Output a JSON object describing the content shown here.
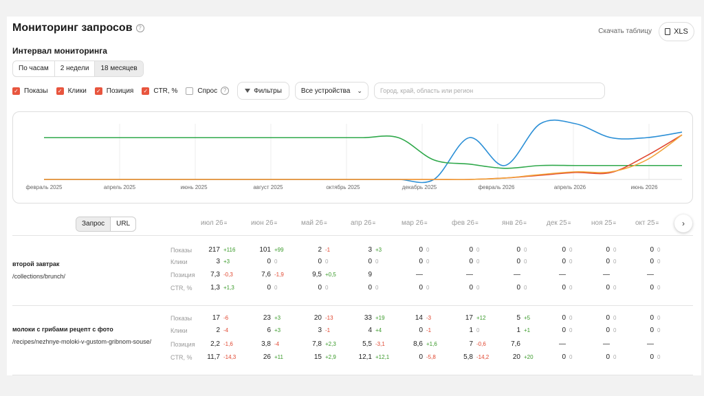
{
  "header": {
    "title": "Мониторинг запросов",
    "download_label": "Скачать таблицу",
    "xls_label": "XLS"
  },
  "interval": {
    "title": "Интервал мониторинга",
    "options": [
      "По часам",
      "2 недели",
      "18 месяцев"
    ],
    "active": 2
  },
  "filters": {
    "checks": [
      {
        "label": "Показы",
        "checked": true
      },
      {
        "label": "Клики",
        "checked": true
      },
      {
        "label": "Позиция",
        "checked": true
      },
      {
        "label": "CTR, %",
        "checked": true
      },
      {
        "label": "Спрос",
        "checked": false
      }
    ],
    "filter_button": "Фильтры",
    "device_select": "Все устройства",
    "region_placeholder": "Город, край, область или регион"
  },
  "chart_data": {
    "type": "line",
    "x_tick_labels": [
      "февраль 2025",
      "апрель 2025",
      "июнь 2025",
      "август 2025",
      "октябрь 2025",
      "декабрь 2025",
      "февраль 2026",
      "апрель 2026",
      "июнь 2026"
    ],
    "x": [
      "2025-01",
      "2025-02",
      "2025-03",
      "2025-04",
      "2025-05",
      "2025-06",
      "2025-07",
      "2025-08",
      "2025-09",
      "2025-10",
      "2025-11",
      "2025-12",
      "2026-01",
      "2026-02",
      "2026-03",
      "2026-04",
      "2026-05",
      "2026-06",
      "2026-07"
    ],
    "series": [
      {
        "color": "#2b8fd6",
        "values": [
          0,
          0,
          0,
          0,
          0,
          0,
          0,
          0,
          0,
          0,
          0,
          0,
          3,
          1,
          4,
          4,
          3,
          3,
          3.4
        ]
      },
      {
        "color": "#2ea84a",
        "values": [
          3,
          3,
          3,
          3,
          3,
          3,
          3,
          3,
          3,
          3,
          3,
          1.4,
          1.1,
          0.8,
          1,
          1,
          1,
          1,
          1
        ]
      },
      {
        "color": "#e0462f",
        "values": [
          0,
          0,
          0,
          0,
          0,
          0,
          0,
          0,
          0,
          0,
          0,
          0,
          0,
          0.1,
          0.3,
          0.5,
          0.5,
          1.7,
          3.2
        ]
      },
      {
        "color": "#f2a33a",
        "values": [
          0,
          0,
          0,
          0,
          0,
          0,
          0,
          0,
          0,
          0,
          0,
          0,
          0,
          0.1,
          0.35,
          0.55,
          0.55,
          1.4,
          3.2
        ]
      }
    ],
    "grid": true
  },
  "table": {
    "tabs": [
      "Запрос",
      "URL"
    ],
    "columns": [
      "июл 26",
      "июн 26",
      "май 26",
      "апр 26",
      "мар 26",
      "фев 26",
      "янв 26",
      "дек 25",
      "ноя 25",
      "окт 25"
    ],
    "metric_labels": [
      "Показы",
      "Клики",
      "Позиция",
      "CTR, %"
    ],
    "rows": [
      {
        "query": "второй завтрак",
        "url": "/collections/brunch/",
        "metrics": [
          [
            {
              "v": "217",
              "d": "+116"
            },
            {
              "v": "101",
              "d": "+99"
            },
            {
              "v": "2",
              "d": "-1"
            },
            {
              "v": "3",
              "d": "+3"
            },
            {
              "v": "0",
              "d": "0"
            },
            {
              "v": "0",
              "d": "0"
            },
            {
              "v": "0",
              "d": "0"
            },
            {
              "v": "0",
              "d": "0"
            },
            {
              "v": "0",
              "d": "0"
            },
            {
              "v": "0",
              "d": "0"
            }
          ],
          [
            {
              "v": "3",
              "d": "+3"
            },
            {
              "v": "0",
              "d": "0"
            },
            {
              "v": "0",
              "d": "0"
            },
            {
              "v": "0",
              "d": "0"
            },
            {
              "v": "0",
              "d": "0"
            },
            {
              "v": "0",
              "d": "0"
            },
            {
              "v": "0",
              "d": "0"
            },
            {
              "v": "0",
              "d": "0"
            },
            {
              "v": "0",
              "d": "0"
            },
            {
              "v": "0",
              "d": "0"
            }
          ],
          [
            {
              "v": "7,3",
              "d": "-0,3"
            },
            {
              "v": "7,6",
              "d": "-1,9"
            },
            {
              "v": "9,5",
              "d": "+0,5"
            },
            {
              "v": "9",
              "d": ""
            },
            {
              "v": "—",
              "d": ""
            },
            {
              "v": "—",
              "d": ""
            },
            {
              "v": "—",
              "d": ""
            },
            {
              "v": "—",
              "d": ""
            },
            {
              "v": "—",
              "d": ""
            },
            {
              "v": "—",
              "d": ""
            }
          ],
          [
            {
              "v": "1,3",
              "d": "+1,3"
            },
            {
              "v": "0",
              "d": "0"
            },
            {
              "v": "0",
              "d": "0"
            },
            {
              "v": "0",
              "d": "0"
            },
            {
              "v": "0",
              "d": "0"
            },
            {
              "v": "0",
              "d": "0"
            },
            {
              "v": "0",
              "d": "0"
            },
            {
              "v": "0",
              "d": "0"
            },
            {
              "v": "0",
              "d": "0"
            },
            {
              "v": "0",
              "d": "0"
            }
          ]
        ]
      },
      {
        "query": "молоки с грибами рецепт с фото",
        "url": "/recipes/nezhnye-moloki-v-gustom-gribnom-souse/",
        "metrics": [
          [
            {
              "v": "17",
              "d": "-6"
            },
            {
              "v": "23",
              "d": "+3"
            },
            {
              "v": "20",
              "d": "-13"
            },
            {
              "v": "33",
              "d": "+19"
            },
            {
              "v": "14",
              "d": "-3"
            },
            {
              "v": "17",
              "d": "+12"
            },
            {
              "v": "5",
              "d": "+5"
            },
            {
              "v": "0",
              "d": "0"
            },
            {
              "v": "0",
              "d": "0"
            },
            {
              "v": "0",
              "d": "0"
            }
          ],
          [
            {
              "v": "2",
              "d": "-4"
            },
            {
              "v": "6",
              "d": "+3"
            },
            {
              "v": "3",
              "d": "-1"
            },
            {
              "v": "4",
              "d": "+4"
            },
            {
              "v": "0",
              "d": "-1"
            },
            {
              "v": "1",
              "d": "0"
            },
            {
              "v": "1",
              "d": "+1"
            },
            {
              "v": "0",
              "d": "0"
            },
            {
              "v": "0",
              "d": "0"
            },
            {
              "v": "0",
              "d": "0"
            }
          ],
          [
            {
              "v": "2,2",
              "d": "-1,6"
            },
            {
              "v": "3,8",
              "d": "-4"
            },
            {
              "v": "7,8",
              "d": "+2,3"
            },
            {
              "v": "5,5",
              "d": "-3,1"
            },
            {
              "v": "8,6",
              "d": "+1,6"
            },
            {
              "v": "7",
              "d": "-0,6"
            },
            {
              "v": "7,6",
              "d": ""
            },
            {
              "v": "—",
              "d": ""
            },
            {
              "v": "—",
              "d": ""
            },
            {
              "v": "—",
              "d": ""
            }
          ],
          [
            {
              "v": "11,7",
              "d": "-14,3"
            },
            {
              "v": "26",
              "d": "+11"
            },
            {
              "v": "15",
              "d": "+2,9"
            },
            {
              "v": "12,1",
              "d": "+12,1"
            },
            {
              "v": "0",
              "d": "-5,8"
            },
            {
              "v": "5,8",
              "d": "-14,2"
            },
            {
              "v": "20",
              "d": "+20"
            },
            {
              "v": "0",
              "d": "0"
            },
            {
              "v": "0",
              "d": "0"
            },
            {
              "v": "0",
              "d": "0"
            }
          ]
        ]
      }
    ]
  }
}
